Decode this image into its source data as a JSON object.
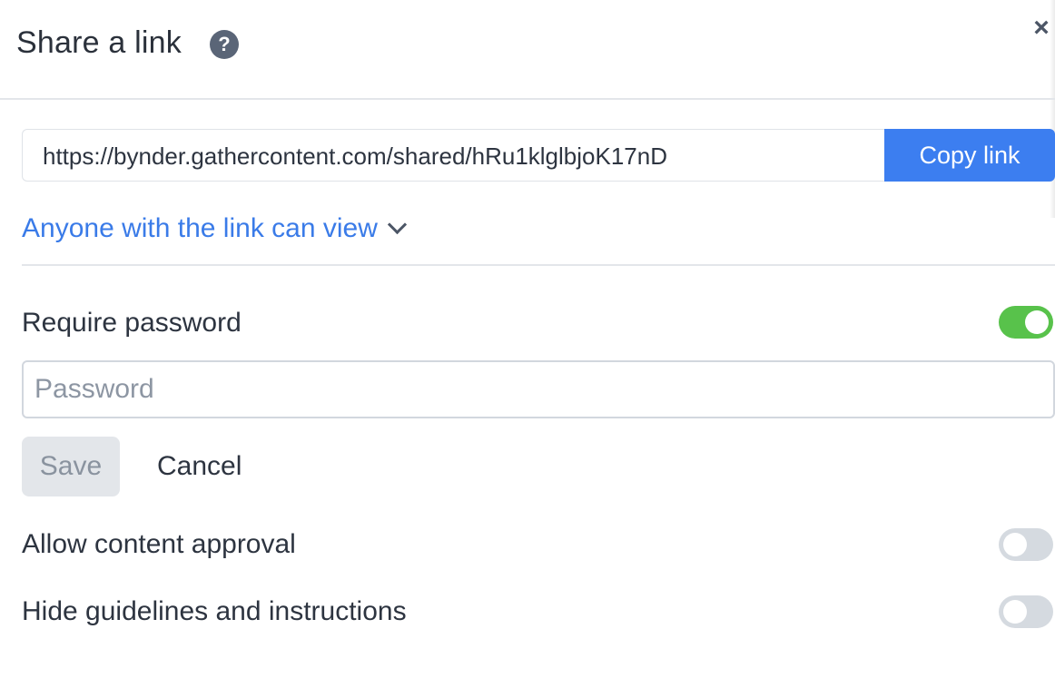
{
  "header": {
    "title": "Share a link",
    "help_icon": "question-circle-icon",
    "help_glyph": "?",
    "close_icon": "close-icon",
    "close_glyph": "×"
  },
  "share": {
    "url": "https://bynder.gathercontent.com/shared/hRu1klglbjoK17nD",
    "copy_label": "Copy link",
    "access_label": "Anyone with the link can view",
    "access_icon": "chevron-down-icon"
  },
  "password": {
    "label": "Require password",
    "enabled": true,
    "placeholder": "Password",
    "value": "",
    "save_label": "Save",
    "cancel_label": "Cancel"
  },
  "options": {
    "content_approval": {
      "label": "Allow content approval",
      "enabled": false
    },
    "hide_guidelines": {
      "label": "Hide guidelines and instructions",
      "enabled": false
    }
  },
  "colors": {
    "primary": "#3c7ef0",
    "link": "#3a7be8",
    "toggle_on": "#58c24b",
    "toggle_off": "#d5dae0",
    "text": "#2d3440"
  }
}
